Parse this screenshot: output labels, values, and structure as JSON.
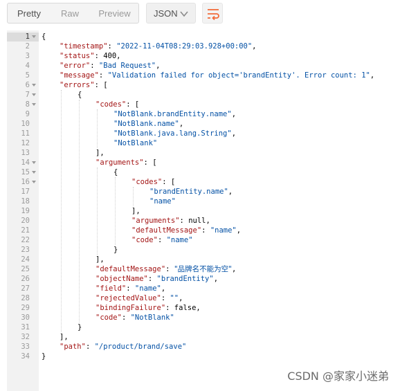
{
  "toolbar": {
    "view_modes": [
      "Pretty",
      "Raw",
      "Preview"
    ],
    "active_view": "Pretty",
    "format": "JSON",
    "wrap_icon": "wrap-lines-icon",
    "accent_color": "#f26b3a"
  },
  "editor": {
    "lines": [
      {
        "n": "1",
        "indent": 0,
        "parts": [
          [
            "p",
            "{"
          ]
        ],
        "fold": true
      },
      {
        "n": "2",
        "indent": 1,
        "parts": [
          [
            "k",
            "\"timestamp\""
          ],
          [
            "p",
            ": "
          ],
          [
            "s",
            "\"2022-11-04T08:29:03.928+00:00\""
          ],
          [
            "p",
            ","
          ]
        ]
      },
      {
        "n": "3",
        "indent": 1,
        "parts": [
          [
            "k",
            "\"status\""
          ],
          [
            "p",
            ": 400,"
          ]
        ]
      },
      {
        "n": "4",
        "indent": 1,
        "parts": [
          [
            "k",
            "\"error\""
          ],
          [
            "p",
            ": "
          ],
          [
            "s",
            "\"Bad Request\""
          ],
          [
            "p",
            ","
          ]
        ]
      },
      {
        "n": "5",
        "indent": 1,
        "parts": [
          [
            "k",
            "\"message\""
          ],
          [
            "p",
            ": "
          ],
          [
            "s",
            "\"Validation failed for object='brandEntity'. Error count: 1\""
          ],
          [
            "p",
            ","
          ]
        ]
      },
      {
        "n": "6",
        "indent": 1,
        "parts": [
          [
            "k",
            "\"errors\""
          ],
          [
            "p",
            ": ["
          ]
        ],
        "fold": true
      },
      {
        "n": "7",
        "indent": 2,
        "parts": [
          [
            "p",
            "{"
          ]
        ],
        "fold": true
      },
      {
        "n": "8",
        "indent": 3,
        "parts": [
          [
            "k",
            "\"codes\""
          ],
          [
            "p",
            ": ["
          ]
        ],
        "fold": true
      },
      {
        "n": "9",
        "indent": 4,
        "parts": [
          [
            "s",
            "\"NotBlank.brandEntity.name\""
          ],
          [
            "p",
            ","
          ]
        ]
      },
      {
        "n": "10",
        "indent": 4,
        "parts": [
          [
            "s",
            "\"NotBlank.name\""
          ],
          [
            "p",
            ","
          ]
        ]
      },
      {
        "n": "11",
        "indent": 4,
        "parts": [
          [
            "s",
            "\"NotBlank.java.lang.String\""
          ],
          [
            "p",
            ","
          ]
        ]
      },
      {
        "n": "12",
        "indent": 4,
        "parts": [
          [
            "s",
            "\"NotBlank\""
          ]
        ]
      },
      {
        "n": "13",
        "indent": 3,
        "parts": [
          [
            "p",
            "],"
          ]
        ]
      },
      {
        "n": "14",
        "indent": 3,
        "parts": [
          [
            "k",
            "\"arguments\""
          ],
          [
            "p",
            ": ["
          ]
        ],
        "fold": true
      },
      {
        "n": "15",
        "indent": 4,
        "parts": [
          [
            "p",
            "{"
          ]
        ],
        "fold": true
      },
      {
        "n": "16",
        "indent": 5,
        "parts": [
          [
            "k",
            "\"codes\""
          ],
          [
            "p",
            ": ["
          ]
        ],
        "fold": true
      },
      {
        "n": "17",
        "indent": 6,
        "parts": [
          [
            "s",
            "\"brandEntity.name\""
          ],
          [
            "p",
            ","
          ]
        ]
      },
      {
        "n": "18",
        "indent": 6,
        "parts": [
          [
            "s",
            "\"name\""
          ]
        ]
      },
      {
        "n": "19",
        "indent": 5,
        "parts": [
          [
            "p",
            "],"
          ]
        ]
      },
      {
        "n": "20",
        "indent": 5,
        "parts": [
          [
            "k",
            "\"arguments\""
          ],
          [
            "p",
            ": null,"
          ]
        ]
      },
      {
        "n": "21",
        "indent": 5,
        "parts": [
          [
            "k",
            "\"defaultMessage\""
          ],
          [
            "p",
            ": "
          ],
          [
            "s",
            "\"name\""
          ],
          [
            "p",
            ","
          ]
        ]
      },
      {
        "n": "22",
        "indent": 5,
        "parts": [
          [
            "k",
            "\"code\""
          ],
          [
            "p",
            ": "
          ],
          [
            "s",
            "\"name\""
          ]
        ]
      },
      {
        "n": "23",
        "indent": 4,
        "parts": [
          [
            "p",
            "}"
          ]
        ]
      },
      {
        "n": "24",
        "indent": 3,
        "parts": [
          [
            "p",
            "],"
          ]
        ]
      },
      {
        "n": "25",
        "indent": 3,
        "parts": [
          [
            "k",
            "\"defaultMessage\""
          ],
          [
            "p",
            ": "
          ],
          [
            "c",
            "\"品牌名不能为空\""
          ],
          [
            "p",
            ","
          ]
        ]
      },
      {
        "n": "26",
        "indent": 3,
        "parts": [
          [
            "k",
            "\"objectName\""
          ],
          [
            "p",
            ": "
          ],
          [
            "s",
            "\"brandEntity\""
          ],
          [
            "p",
            ","
          ]
        ]
      },
      {
        "n": "27",
        "indent": 3,
        "parts": [
          [
            "k",
            "\"field\""
          ],
          [
            "p",
            ": "
          ],
          [
            "s",
            "\"name\""
          ],
          [
            "p",
            ","
          ]
        ]
      },
      {
        "n": "28",
        "indent": 3,
        "parts": [
          [
            "k",
            "\"rejectedValue\""
          ],
          [
            "p",
            ": "
          ],
          [
            "s",
            "\"\""
          ],
          [
            "p",
            ","
          ]
        ]
      },
      {
        "n": "29",
        "indent": 3,
        "parts": [
          [
            "k",
            "\"bindingFailure\""
          ],
          [
            "p",
            ": false,"
          ]
        ]
      },
      {
        "n": "30",
        "indent": 3,
        "parts": [
          [
            "k",
            "\"code\""
          ],
          [
            "p",
            ": "
          ],
          [
            "s",
            "\"NotBlank\""
          ]
        ]
      },
      {
        "n": "31",
        "indent": 2,
        "parts": [
          [
            "p",
            "}"
          ]
        ]
      },
      {
        "n": "32",
        "indent": 1,
        "parts": [
          [
            "p",
            "],"
          ]
        ]
      },
      {
        "n": "33",
        "indent": 1,
        "parts": [
          [
            "k",
            "\"path\""
          ],
          [
            "p",
            ": "
          ],
          [
            "s",
            "\"/product/brand/save\""
          ]
        ]
      },
      {
        "n": "34",
        "indent": 0,
        "parts": [
          [
            "p",
            "}"
          ]
        ]
      }
    ]
  },
  "watermark": "CSDN @家家小迷弟"
}
